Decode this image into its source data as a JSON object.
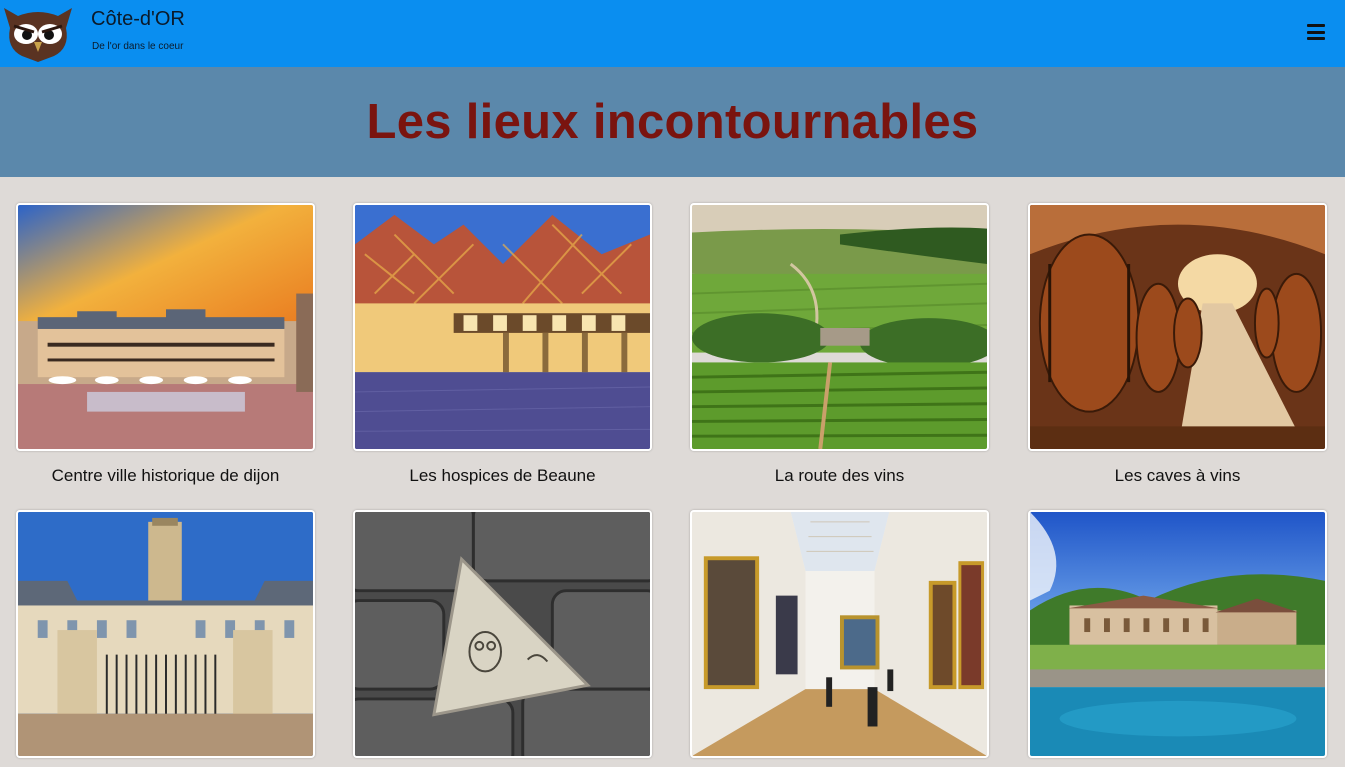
{
  "header": {
    "logo_icon": "owl-logo-icon",
    "title": "Côte-d'OR",
    "subtitle": "De l'or dans le coeur",
    "menu_icon": "hamburger-menu-icon"
  },
  "hero": {
    "title": "Les lieux incontournables"
  },
  "places": [
    {
      "caption": "Centre ville historique de dijon",
      "image": "dijon-square-photo"
    },
    {
      "caption": "Les hospices de Beaune",
      "image": "beaune-hospices-photo"
    },
    {
      "caption": "La route des vins",
      "image": "vineyard-road-photo"
    },
    {
      "caption": "Les caves à vins",
      "image": "wine-cellar-photo"
    },
    {
      "caption": "",
      "image": "ducal-palace-photo"
    },
    {
      "caption": "",
      "image": "owl-trail-plaque-photo"
    },
    {
      "caption": "",
      "image": "museum-gallery-photo"
    },
    {
      "caption": "",
      "image": "fontenay-abbey-photo"
    }
  ],
  "colors": {
    "topbar": "#0a8ef0",
    "hero_bg": "#5b88ab",
    "hero_title": "#7a140f",
    "page_bg": "#dedad7"
  }
}
